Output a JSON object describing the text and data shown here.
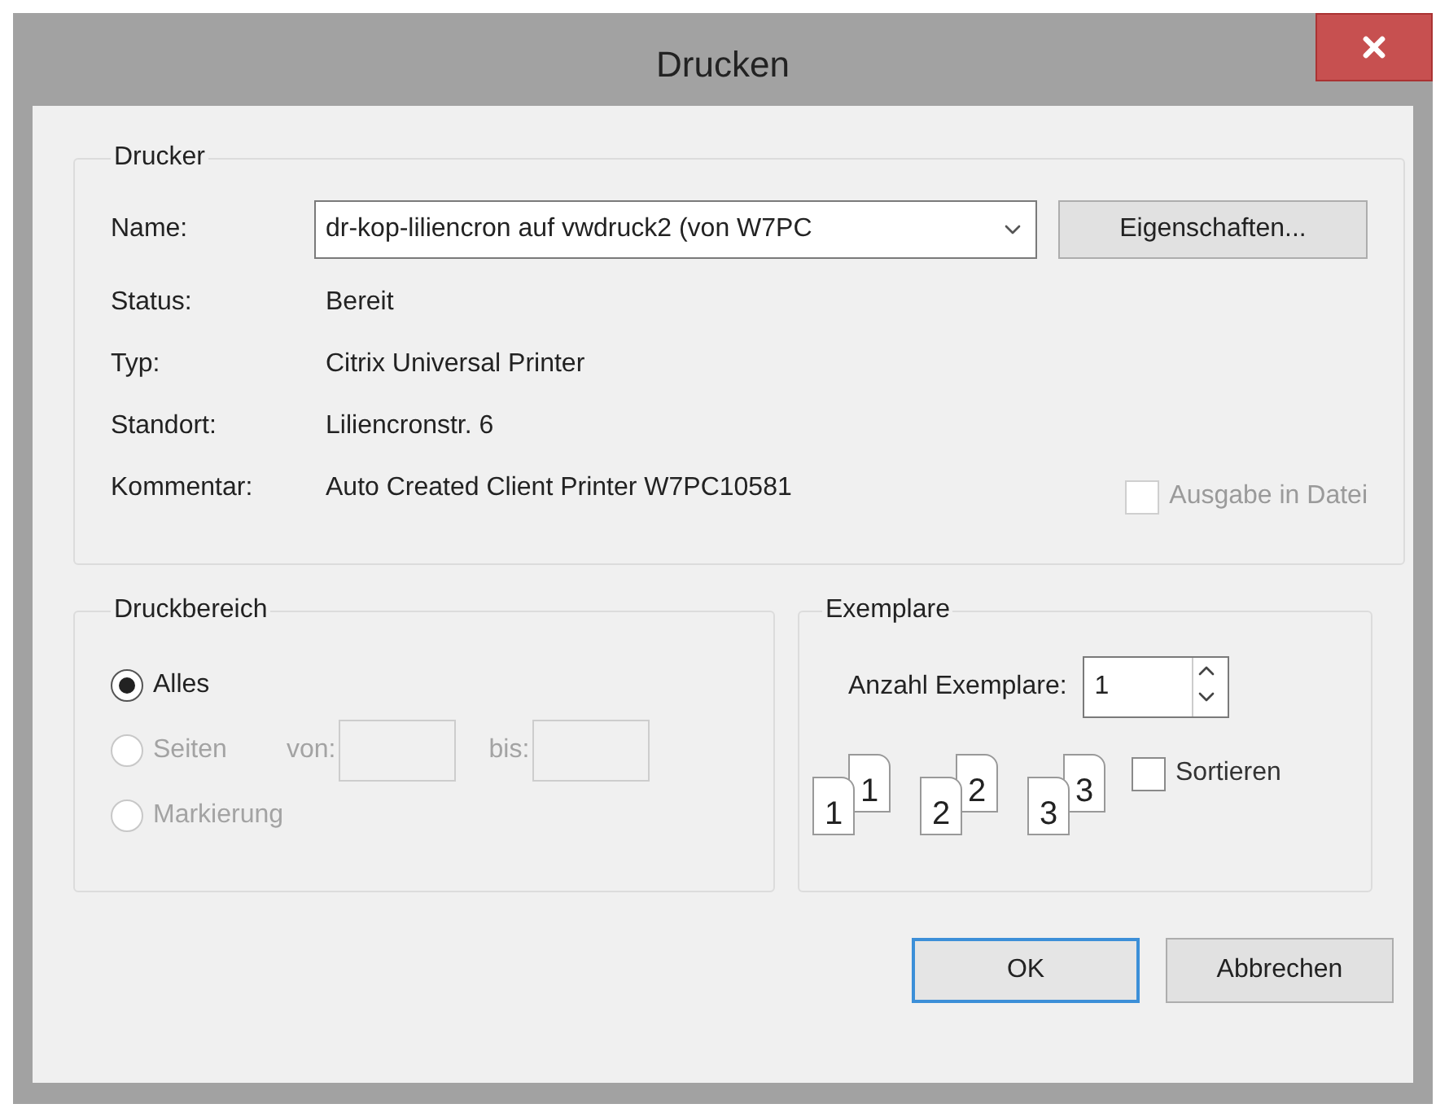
{
  "window": {
    "title": "Drucken"
  },
  "printer": {
    "title": "Drucker",
    "name_label": "Name:",
    "name_value": "dr-kop-liliencron auf vwdruck2 (von W7PC",
    "properties_button": "Eigenschaften...",
    "info": [
      {
        "label": "Status:",
        "value": "Bereit"
      },
      {
        "label": "Typ:",
        "value": "Citrix Universal Printer"
      },
      {
        "label": "Standort:",
        "value": "Liliencronstr. 6"
      },
      {
        "label": "Kommentar:",
        "value": "Auto Created Client Printer W7PC10581"
      }
    ],
    "print_to_file": {
      "label": "Ausgabe in Datei",
      "checked": false,
      "disabled": true
    }
  },
  "range": {
    "title": "Druckbereich",
    "options": [
      {
        "kind": "plain",
        "label": "Alles",
        "selected": true,
        "disabled": false
      },
      {
        "kind": "pages",
        "label": "Seiten",
        "selected": false,
        "disabled": true,
        "from_label": "von:",
        "to_label": "bis:"
      },
      {
        "kind": "plain",
        "label": "Markierung",
        "selected": false,
        "disabled": true
      }
    ]
  },
  "copies": {
    "title": "Exemplare",
    "count_label": "Anzahl Exemplare:",
    "count_value": "1",
    "collate_pages": [
      [
        "1",
        "1"
      ],
      [
        "2",
        "2"
      ],
      [
        "3",
        "3"
      ]
    ],
    "collate": {
      "label": "Sortieren",
      "checked": false,
      "disabled": false
    }
  },
  "buttons": [
    {
      "label": "OK",
      "default": true
    },
    {
      "label": "Abbrechen",
      "default": false
    }
  ]
}
